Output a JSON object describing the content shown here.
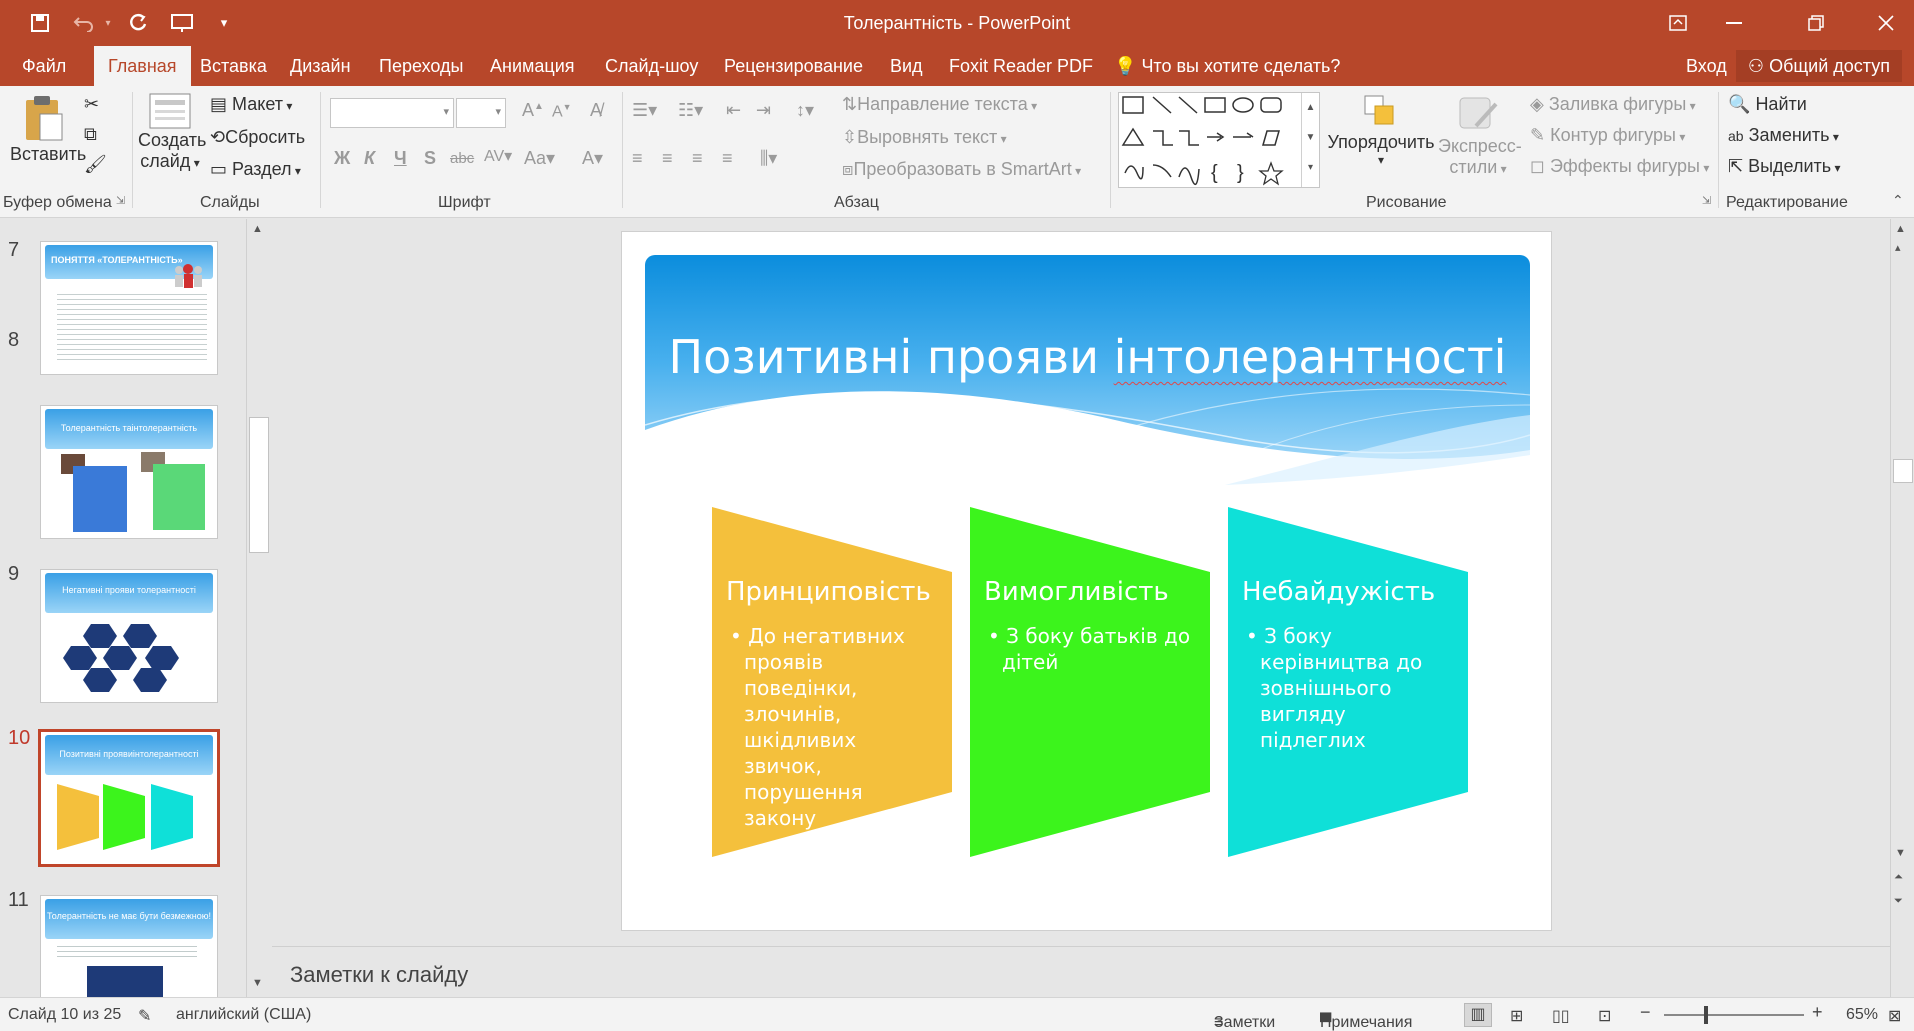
{
  "window": {
    "title": "Толерантність - PowerPoint"
  },
  "tabs": [
    {
      "label": "Файл"
    },
    {
      "label": "Главная"
    },
    {
      "label": "Вставка"
    },
    {
      "label": "Дизайн"
    },
    {
      "label": "Переходы"
    },
    {
      "label": "Анимация"
    },
    {
      "label": "Слайд-шоу"
    },
    {
      "label": "Рецензирование"
    },
    {
      "label": "Вид"
    },
    {
      "label": "Foxit Reader PDF"
    }
  ],
  "tell_me": "Что вы хотите сделать?",
  "sign_in": "Вход",
  "share": "Общий доступ",
  "ribbon": {
    "clipboard": {
      "paste": "Вставить",
      "label": "Буфер обмена"
    },
    "slides": {
      "new_slide_1": "Создать",
      "new_slide_2": "слайд",
      "layout": "Макет",
      "reset": "Сбросить",
      "section": "Раздел",
      "label": "Слайды"
    },
    "font": {
      "label": "Шрифт"
    },
    "paragraph": {
      "text_direction": "Направление текста",
      "align_text": "Выровнять текст",
      "smartart": "Преобразовать в SmartArt",
      "label": "Абзац"
    },
    "drawing": {
      "arrange": "Упорядочить",
      "quick_styles_1": "Экспресс-",
      "quick_styles_2": "стили",
      "shape_fill": "Заливка фигуры",
      "shape_outline": "Контур фигуры",
      "shape_effects": "Эффекты фигуры",
      "label": "Рисование"
    },
    "editing": {
      "find": "Найти",
      "replace": "Заменить",
      "select": "Выделить",
      "label": "Редактирование"
    }
  },
  "thumbnails": [
    {
      "num": "7",
      "title": "ПОНЯТТЯ «ТОЛЕРАНТНІСТЬ»"
    },
    {
      "num": "8",
      "title": "Толерантність таінтолерантність"
    },
    {
      "num": "9",
      "title": "Негативні прояви толерантності"
    },
    {
      "num": "10",
      "title": "Позитивні проявиінтолерантності"
    },
    {
      "num": "11",
      "title": "Толерантність не має бути безмежною!"
    }
  ],
  "slide": {
    "title_a": "Позитивні прояви ",
    "title_b": "інтолерантності",
    "cards": [
      {
        "title": "Принциповість",
        "bullet": "До негативних проявів поведінки, злочинів, шкідливих звичок, порушення закону",
        "color": "#f4c03c"
      },
      {
        "title": "Вимогливість",
        "bullet": "З боку батьків до дітей",
        "color": "#3cf41c"
      },
      {
        "title": "Небайдужість",
        "bullet": "З боку керівництва до зовнішнього вигляду підлеглих",
        "color": "#0fe0d8"
      }
    ]
  },
  "notes_placeholder": "Заметки к слайду",
  "status": {
    "slide_of": "Слайд 10 из 25",
    "language": "английский (США)",
    "notes": "Заметки",
    "comments": "Примечания",
    "zoom": "65%"
  }
}
